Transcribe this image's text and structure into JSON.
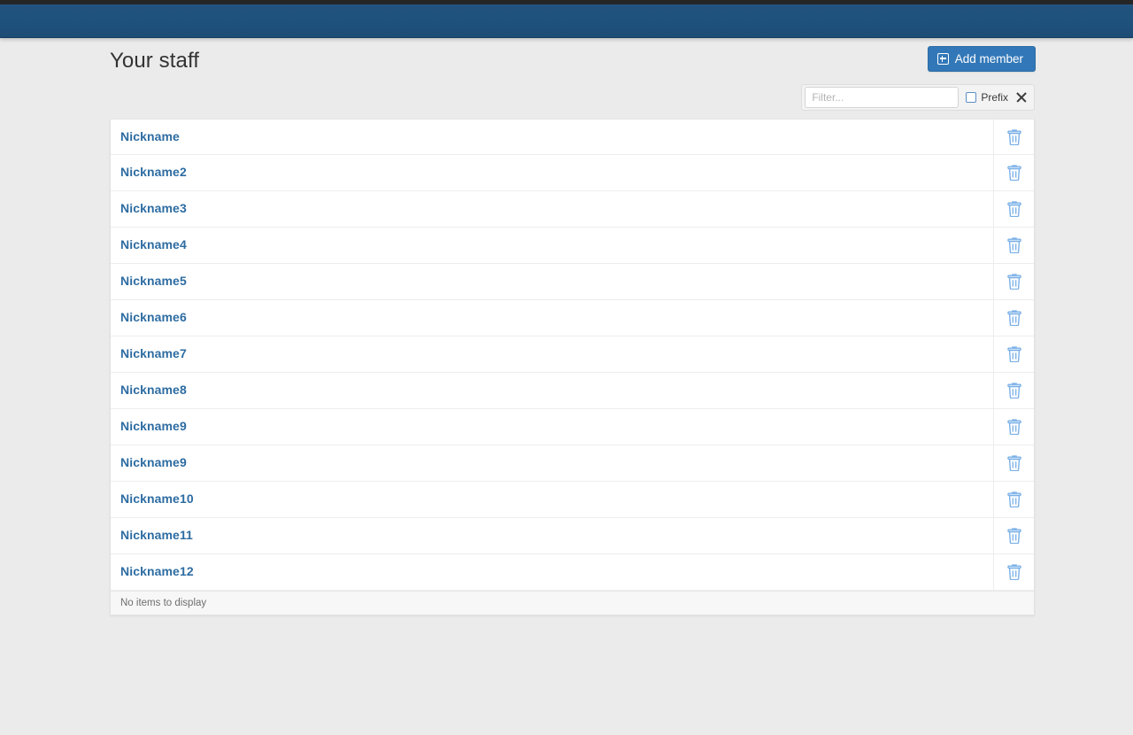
{
  "colors": {
    "navbar": "#1f517d",
    "accent": "#3278b8",
    "link": "#2d6ca2",
    "page_background": "#ebebeb",
    "trash_icon": "#7ab0e8"
  },
  "navbar": {
    "title": ""
  },
  "header": {
    "page_title": "Your staff",
    "add_member_label": "Add member",
    "add_member_icon": "plus-square-icon"
  },
  "filter": {
    "placeholder": "Filter...",
    "value": "",
    "prefix_label": "Prefix",
    "prefix_checked": false,
    "close_icon": "close-icon"
  },
  "staff_list": {
    "row_action_icon": "trash-icon",
    "rows": [
      {
        "name": "Nickname"
      },
      {
        "name": "Nickname2"
      },
      {
        "name": "Nickname3"
      },
      {
        "name": "Nickname4"
      },
      {
        "name": "Nickname5"
      },
      {
        "name": "Nickname6"
      },
      {
        "name": "Nickname7"
      },
      {
        "name": "Nickname8"
      },
      {
        "name": "Nickname9"
      },
      {
        "name": "Nickname9"
      },
      {
        "name": "Nickname10"
      },
      {
        "name": "Nickname11"
      },
      {
        "name": "Nickname12"
      }
    ],
    "empty_message": "No items to display"
  }
}
